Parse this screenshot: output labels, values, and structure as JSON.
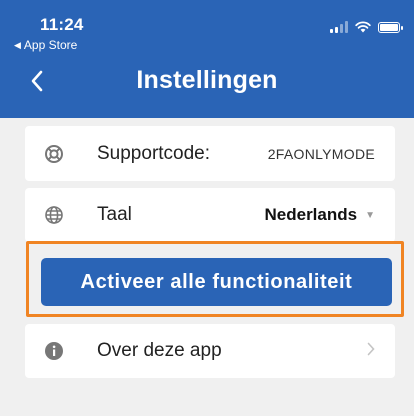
{
  "status_bar": {
    "time": "11:24",
    "back_app": "App Store"
  },
  "header": {
    "title": "Instellingen",
    "back_icon": "chevron-left-icon"
  },
  "settings": {
    "supportcode": {
      "label": "Supportcode:",
      "value": "2FAONLYMODE",
      "icon": "lifebuoy-icon"
    },
    "language": {
      "label": "Taal",
      "value": "Nederlands",
      "icon": "globe-icon"
    },
    "activate_button": "Activeer alle functionaliteit",
    "about": {
      "label": "Over deze app",
      "icon": "info-icon"
    }
  },
  "colors": {
    "brand_blue": "#2a64b6",
    "highlight_orange": "#f08423",
    "background": "#f0f0f0"
  }
}
